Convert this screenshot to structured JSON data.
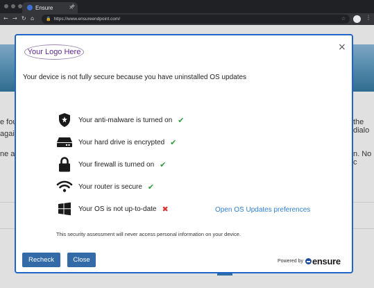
{
  "browser": {
    "tab_title": "Ensure",
    "tab_close": "×",
    "new_tab": "+",
    "nav": {
      "back": "←",
      "forward": "→",
      "reload": "↻",
      "home": "⌂"
    },
    "url": "https://www.ensureendpoint.com/",
    "menu": "⋮"
  },
  "background": {
    "snippets": [
      {
        "text": "e fou"
      },
      {
        "text": "again"
      },
      {
        "text": "ne a"
      },
      {
        "text": "the dialo"
      },
      {
        "text": "n. No c"
      }
    ]
  },
  "modal": {
    "logo_text": "Your Logo Here",
    "close_glyph": "×",
    "headline": "Your device is not fully secure because you have uninstalled OS updates",
    "items": [
      {
        "icon": "shield-icon",
        "text": "Your anti-malware is turned on",
        "status": "ok",
        "mark": "✔"
      },
      {
        "icon": "hard-drive-icon",
        "text": "Your hard drive is encrypted",
        "status": "ok",
        "mark": "✔"
      },
      {
        "icon": "lock-icon",
        "text": "Your firewall is turned on",
        "status": "ok",
        "mark": "✔"
      },
      {
        "icon": "wifi-icon",
        "text": "Your router is secure",
        "status": "ok",
        "mark": "✔"
      },
      {
        "icon": "windows-icon",
        "text": "Your OS is not up-to-date",
        "status": "fail",
        "mark": "✖"
      }
    ],
    "os_link": "Open OS Updates preferences",
    "disclaimer": "This security assessment will never access personal information on your device.",
    "buttons": {
      "recheck": "Recheck",
      "close": "Close"
    },
    "powered_by": "Powered by",
    "brand": "ensure"
  },
  "colors": {
    "accent": "#1f65c7",
    "button": "#336ba8",
    "link": "#2f7fd1",
    "ok": "#2e9b3a",
    "fail": "#d8352d",
    "logo": "#5e2a8c"
  }
}
